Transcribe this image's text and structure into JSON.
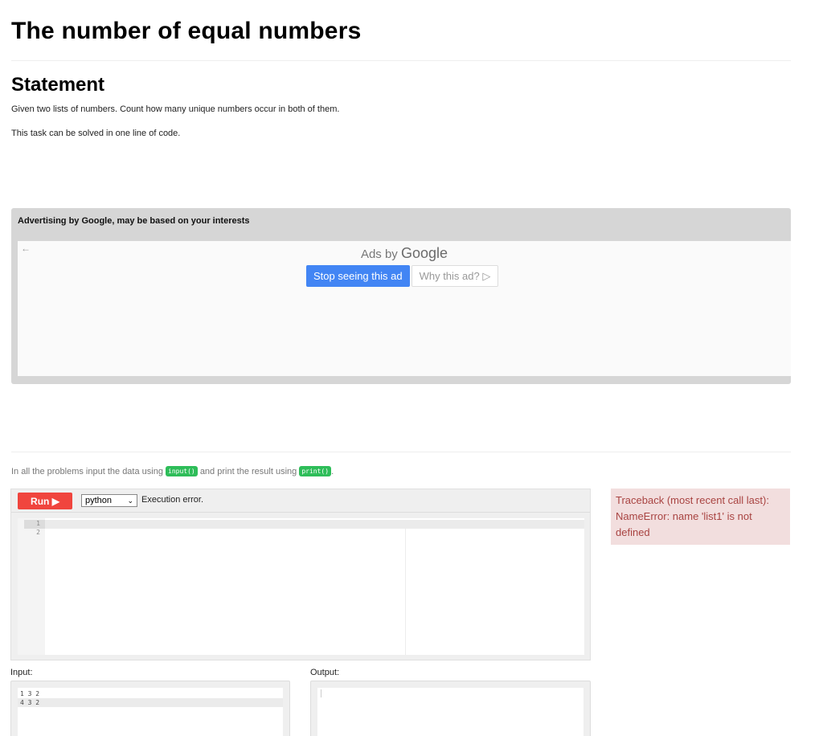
{
  "page": {
    "title": "The number of equal numbers"
  },
  "statement": {
    "heading": "Statement",
    "paragraphs": [
      "Given two lists of numbers. Count how many unique numbers occur in both of them.",
      "This task can be solved in one line of code."
    ]
  },
  "ad": {
    "header": "Advertising by Google, may be based on your interests",
    "back_icon": "arrow-left-icon",
    "ads_by_prefix": "Ads by",
    "ads_by_brand": "Google",
    "stop_label": "Stop seeing this ad",
    "why_label": "Why this ad?",
    "why_icon": "adchoices-triangle-icon",
    "colors": {
      "stop_button": "#4285f4"
    }
  },
  "intro": {
    "before": "In all the problems input the data using",
    "input_code": "input()",
    "middle": "and print the result using",
    "print_code": "print()",
    "after": "."
  },
  "editor": {
    "run_label": "Run",
    "run_icon": "play-triangle-icon",
    "language": "python",
    "status": "Execution error.",
    "line_numbers": [
      "1",
      "2"
    ],
    "colors": {
      "run_button": "#f0453e"
    }
  },
  "error": {
    "text": "Traceback (most recent call last):\nNameError: name 'list1' is not defined",
    "colors": {
      "background": "#f2dede",
      "text": "#a94442"
    }
  },
  "io": {
    "input_label": "Input:",
    "output_label": "Output:",
    "input_lines": [
      "1 3 2",
      "4 3 2"
    ],
    "output_lines": []
  }
}
